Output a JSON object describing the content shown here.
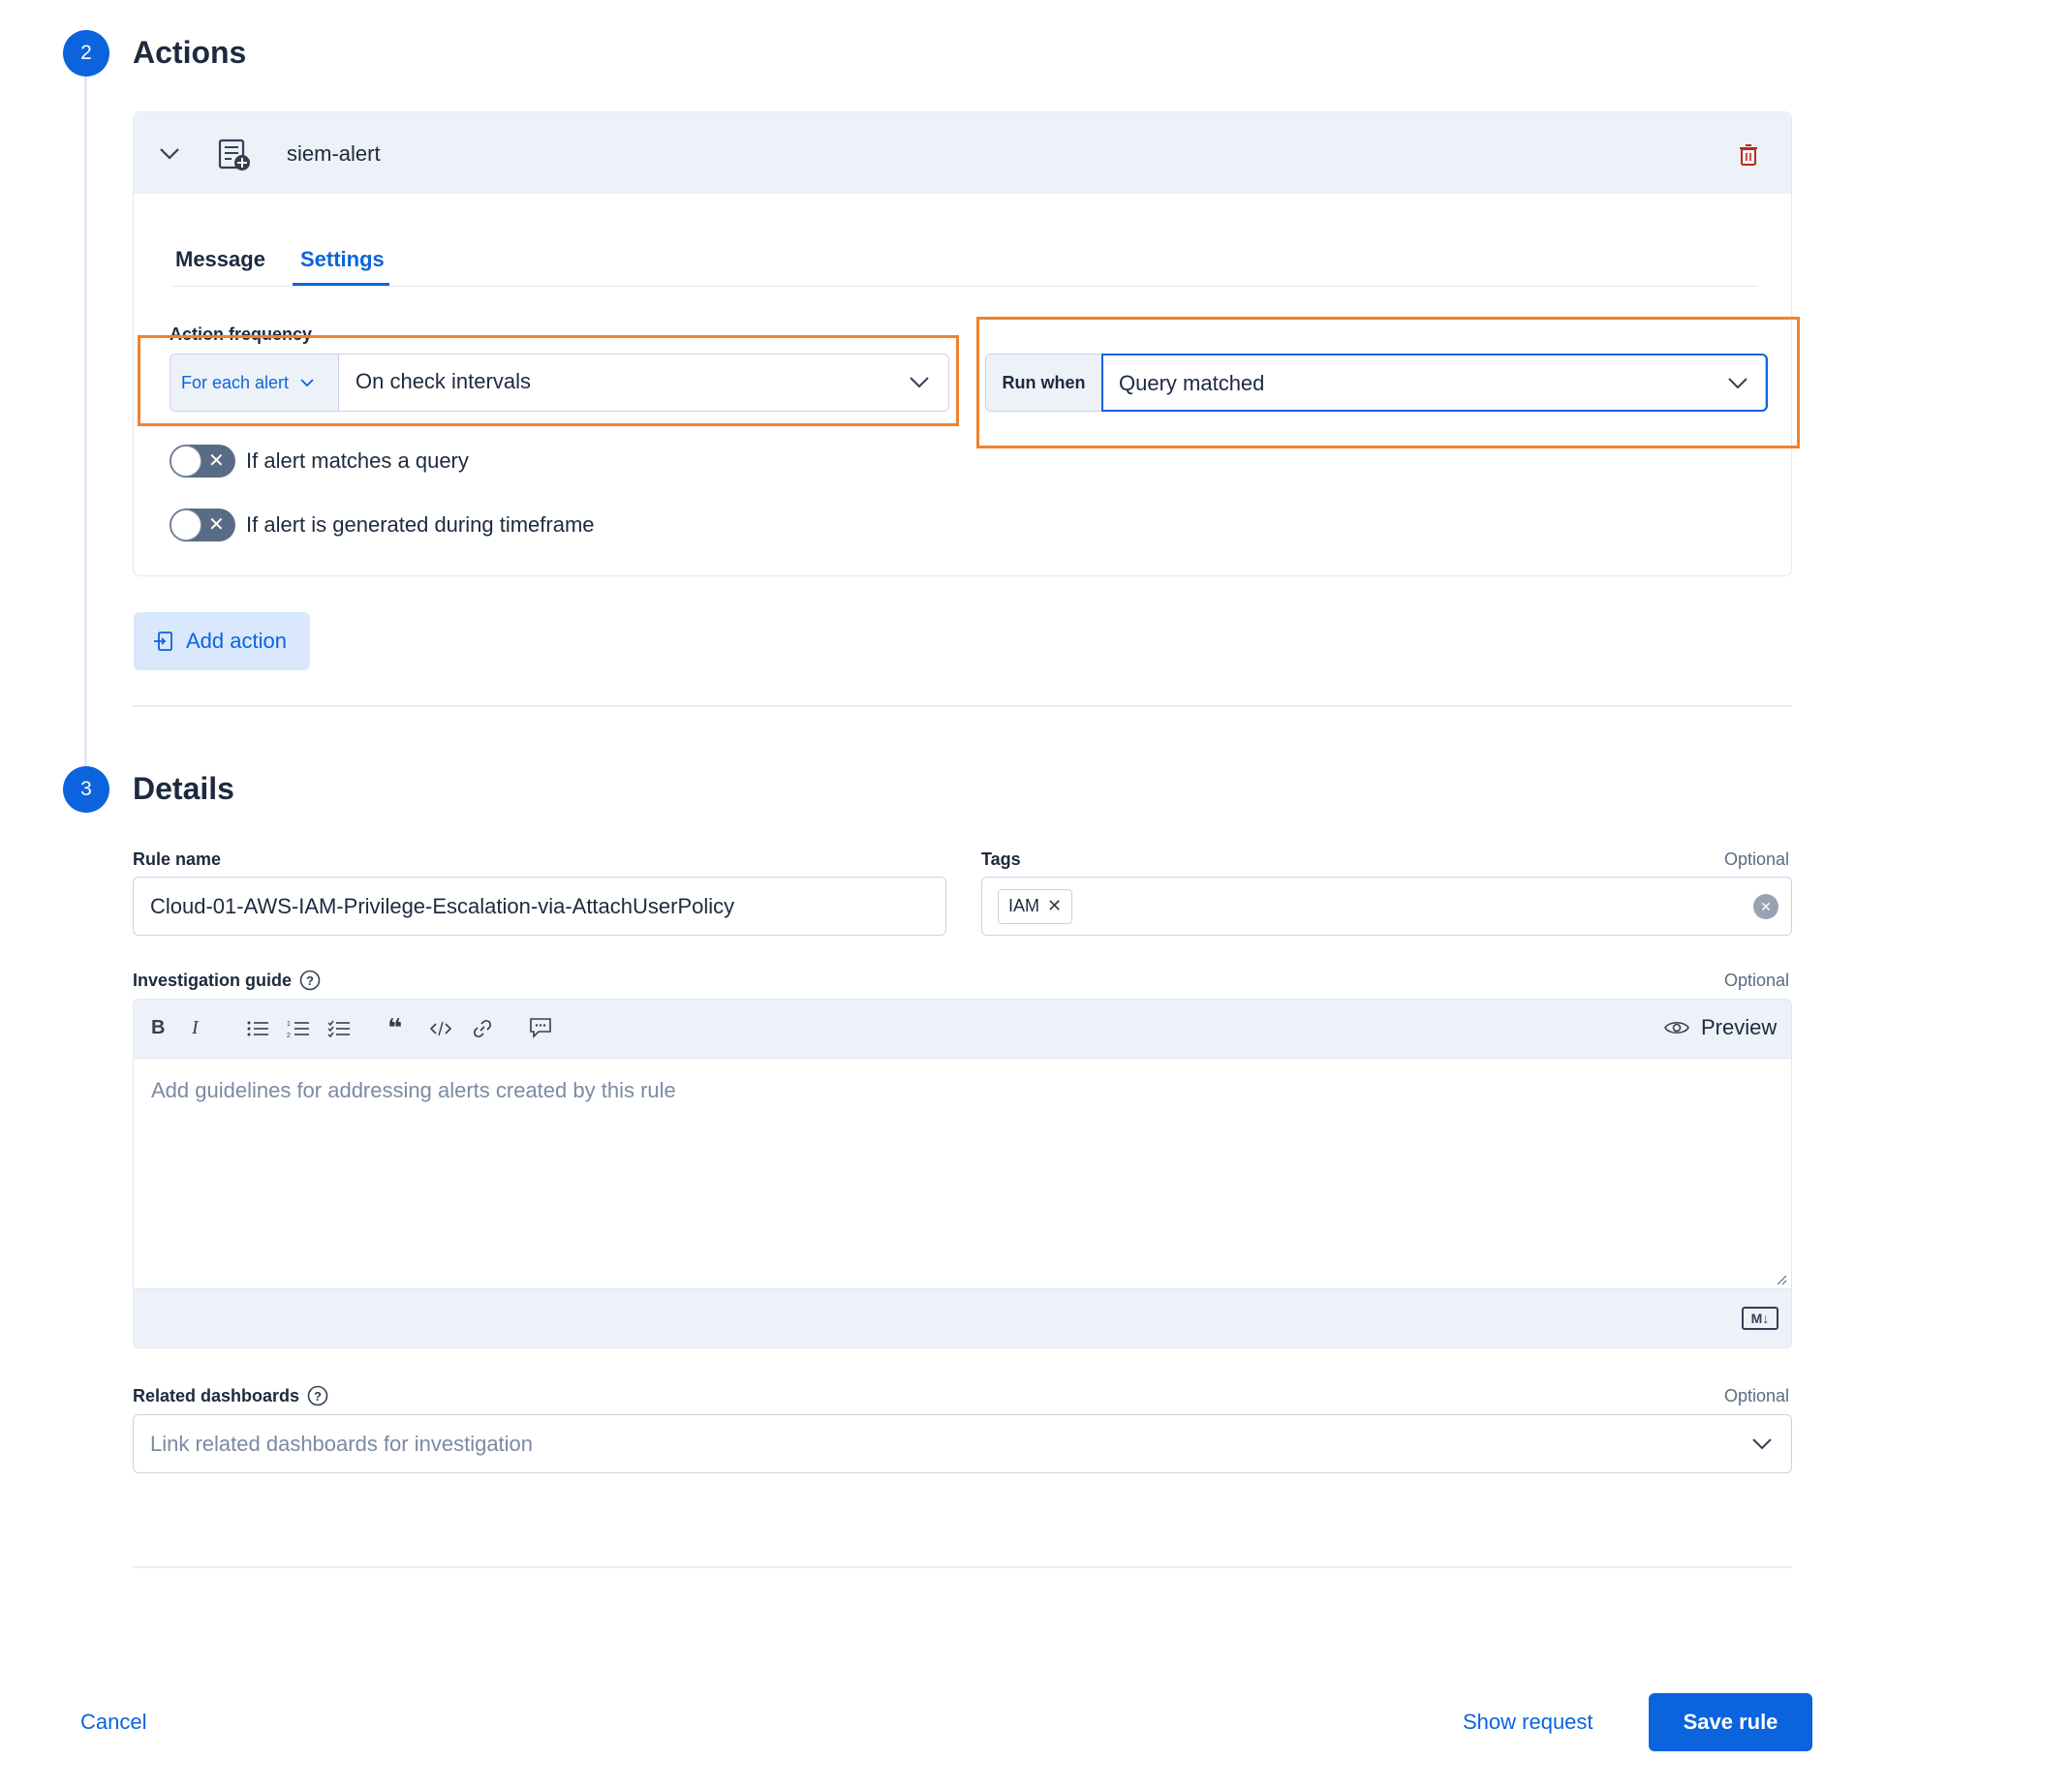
{
  "actions_section": {
    "step_number": "2",
    "title": "Actions",
    "connector_name": "siem-alert",
    "tabs": [
      {
        "label": "Message"
      },
      {
        "label": "Settings"
      }
    ],
    "action_frequency_label": "Action frequency",
    "frequency_prepend": "For each alert",
    "frequency_value": "On check intervals",
    "run_when_label": "Run when",
    "run_when_value": "Query matched",
    "toggle_query_label": "If alert matches a query",
    "toggle_timeframe_label": "If alert is generated during timeframe",
    "add_action_label": "Add action"
  },
  "details_section": {
    "step_number": "3",
    "title": "Details",
    "rule_name_label": "Rule name",
    "rule_name_value": "Cloud-01-AWS-IAM-Privilege-Escalation-via-AttachUserPolicy",
    "tags_label": "Tags",
    "tags_optional": "Optional",
    "tags": [
      "IAM"
    ],
    "investigation_label": "Investigation guide",
    "investigation_optional": "Optional",
    "preview_label": "Preview",
    "investigation_placeholder": "Add guidelines for addressing alerts created by this rule",
    "markdown_badge": "M↓",
    "dashboards_label": "Related dashboards",
    "dashboards_optional": "Optional",
    "dashboards_placeholder": "Link related dashboards for investigation"
  },
  "footer": {
    "cancel_label": "Cancel",
    "show_request_label": "Show request",
    "save_label": "Save rule"
  },
  "colors": {
    "accent": "#0b64dd",
    "highlight": "#f0822d",
    "danger": "#bd271e"
  }
}
